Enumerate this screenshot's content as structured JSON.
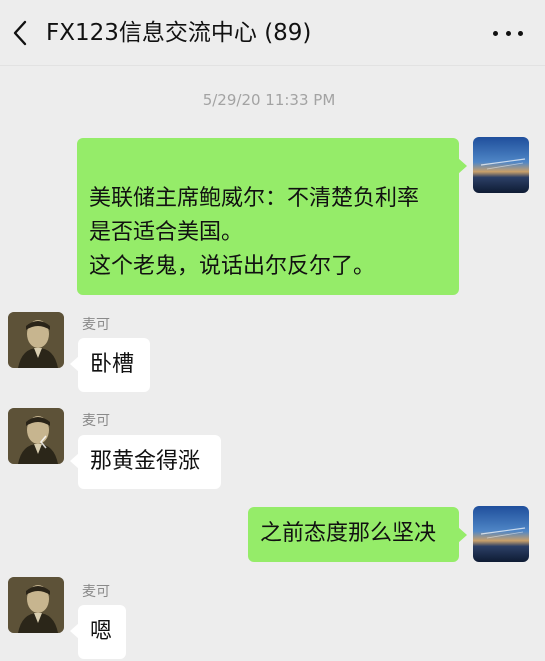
{
  "header": {
    "title": "FX123信息交流中心 (89)"
  },
  "chat": {
    "timestamp": "5/29/20 11:33 PM",
    "messages": [
      {
        "sender": "me",
        "lines": [
          "美联储主席鲍威尔：不清楚负利率",
          "是否适合美国。",
          "这个老鬼，说话出尔反尔了。"
        ]
      },
      {
        "sender": "other",
        "name": "麦可",
        "text": "卧槽"
      },
      {
        "sender": "other",
        "name": "麦可",
        "text": "那黄金得涨"
      },
      {
        "sender": "me",
        "text": "之前态度那么坚决"
      },
      {
        "sender": "other",
        "name": "麦可",
        "text": "嗯"
      }
    ]
  },
  "colors": {
    "background": "#ededed",
    "my_bubble": "#95ec69",
    "other_bubble": "#ffffff",
    "timestamp_text": "#a3a3a3"
  },
  "icons": [
    "back-arrow-icon",
    "more-dots-icon"
  ]
}
